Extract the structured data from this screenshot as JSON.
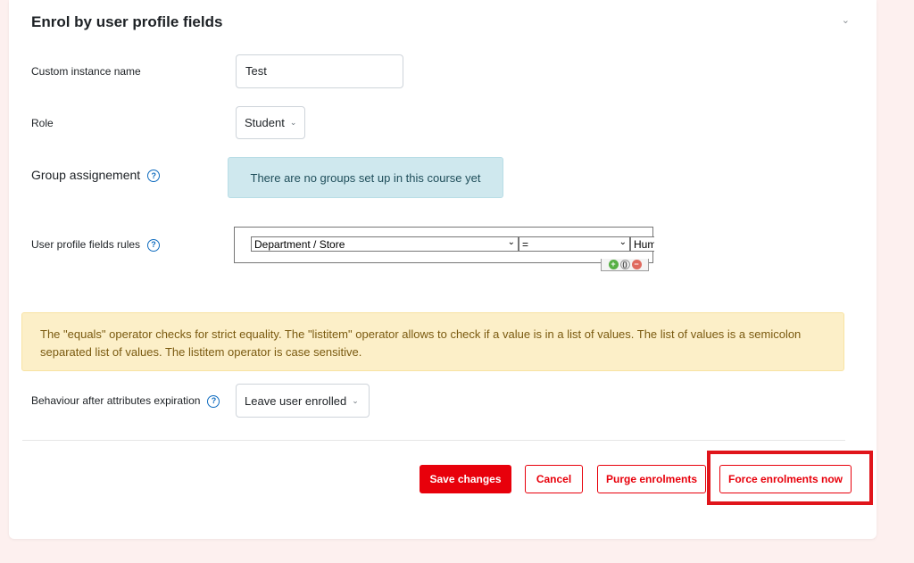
{
  "section": {
    "title": "Enrol by user profile fields",
    "collapse_icon": "chevron-down-icon"
  },
  "fields": {
    "instance_name": {
      "label": "Custom instance name",
      "value": "Test"
    },
    "role": {
      "label": "Role",
      "selected": "Student"
    },
    "group": {
      "label": "Group assignement",
      "info": "There are no groups set up in this course yet"
    },
    "rules": {
      "label": "User profile fields rules",
      "field_selected": "Department / Store",
      "operator_selected": "=",
      "value_partial": "Huma"
    },
    "behaviour": {
      "label": "Behaviour after attributes expiration",
      "selected": "Leave user enrolled"
    }
  },
  "warning": {
    "text": "The \"equals\" operator checks for strict equality. The \"listitem\" operator allows to check if a value is in a list of values. The list of values is a semicolon separated list of values. The listitem operator is case sensitive."
  },
  "buttons": {
    "save": "Save changes",
    "cancel": "Cancel",
    "purge": "Purge enrolments",
    "force": "Force enrolments now"
  },
  "colors": {
    "accent": "#e8000b",
    "highlight": "#e0151b",
    "info_bg": "#cfe8ee",
    "warning_bg": "#fcefc8"
  }
}
